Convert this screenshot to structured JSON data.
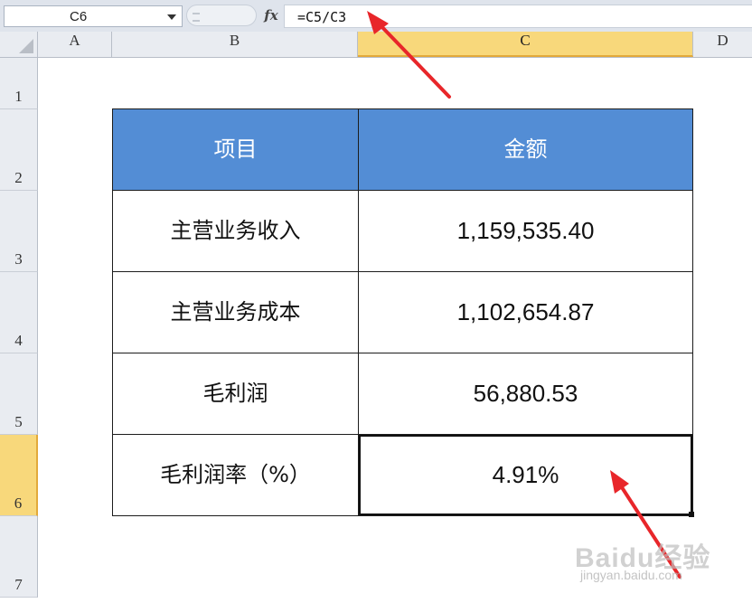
{
  "formula_bar": {
    "name_box": "C6",
    "fx_label": "fx",
    "formula": "=C5/C3"
  },
  "columns": [
    "A",
    "B",
    "C",
    "D"
  ],
  "rows": [
    "1",
    "2",
    "3",
    "4",
    "5",
    "6",
    "7"
  ],
  "selection": {
    "column": "C",
    "row": "6"
  },
  "table": {
    "headers": [
      "项目",
      "金额"
    ],
    "rows": [
      {
        "item": "主营业务收入",
        "amount": "1,159,535.40"
      },
      {
        "item": "主营业务成本",
        "amount": "1,102,654.87"
      },
      {
        "item": "毛利润",
        "amount": "56,880.53"
      },
      {
        "item": "毛利润率（%）",
        "amount": "4.91%"
      }
    ]
  },
  "watermark": {
    "main": "Baidu经验",
    "sub": "jingyan.baidu.com"
  },
  "colors": {
    "header_fill": "#538dd5",
    "selection_highlight": "#f8d87b",
    "annotation_arrow": "#e8262a"
  }
}
